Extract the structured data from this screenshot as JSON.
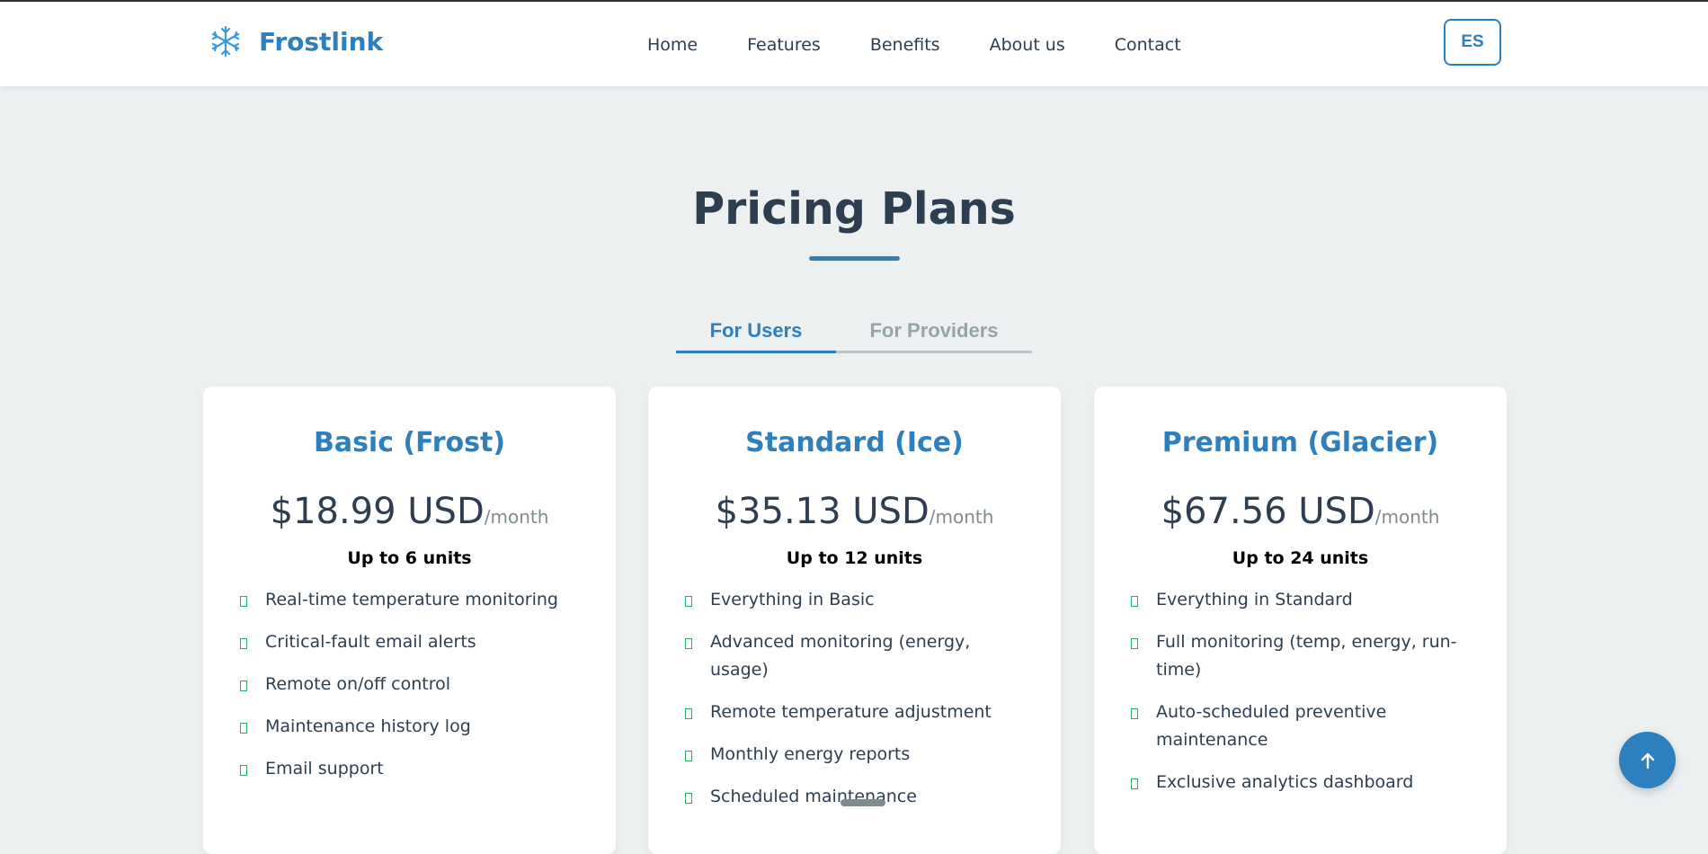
{
  "header": {
    "logo_text": "Frostlink",
    "logo_icon": "snowflake-icon",
    "nav": [
      "Home",
      "Features",
      "Benefits",
      "About us",
      "Contact"
    ],
    "lang_label": "ES"
  },
  "pricing": {
    "title": "Pricing Plans",
    "tabs": [
      "For Users",
      "For Providers"
    ],
    "active_tab": "For Users",
    "plans": [
      {
        "name": "Basic (Frost)",
        "price": "$18.99 USD",
        "period": "/month",
        "units": "Up to 6 units",
        "features": [
          "Real-time temperature monitoring",
          "Critical-fault email alerts",
          "Remote on/off control",
          "Maintenance history log",
          "Email support"
        ]
      },
      {
        "name": "Standard (Ice)",
        "price": "$35.13 USD",
        "period": "/month",
        "units": "Up to 12 units",
        "features": [
          "Everything in Basic",
          "Advanced monitoring (energy, usage)",
          "Remote temperature adjustment",
          "Monthly energy reports",
          "Scheduled maintenance"
        ]
      },
      {
        "name": "Premium (Glacier)",
        "price": "$67.56 USD",
        "period": "/month",
        "units": "Up to 24 units",
        "features": [
          "Everything in Standard",
          "Full monitoring (temp, energy, run-time)",
          "Auto-scheduled preventive maintenance",
          "Exclusive analytics dashboard"
        ]
      }
    ]
  },
  "colors": {
    "brand": "#2d7fbd",
    "text": "#2c3e50",
    "check": "#27ae60",
    "background": "#ecf0f1"
  }
}
